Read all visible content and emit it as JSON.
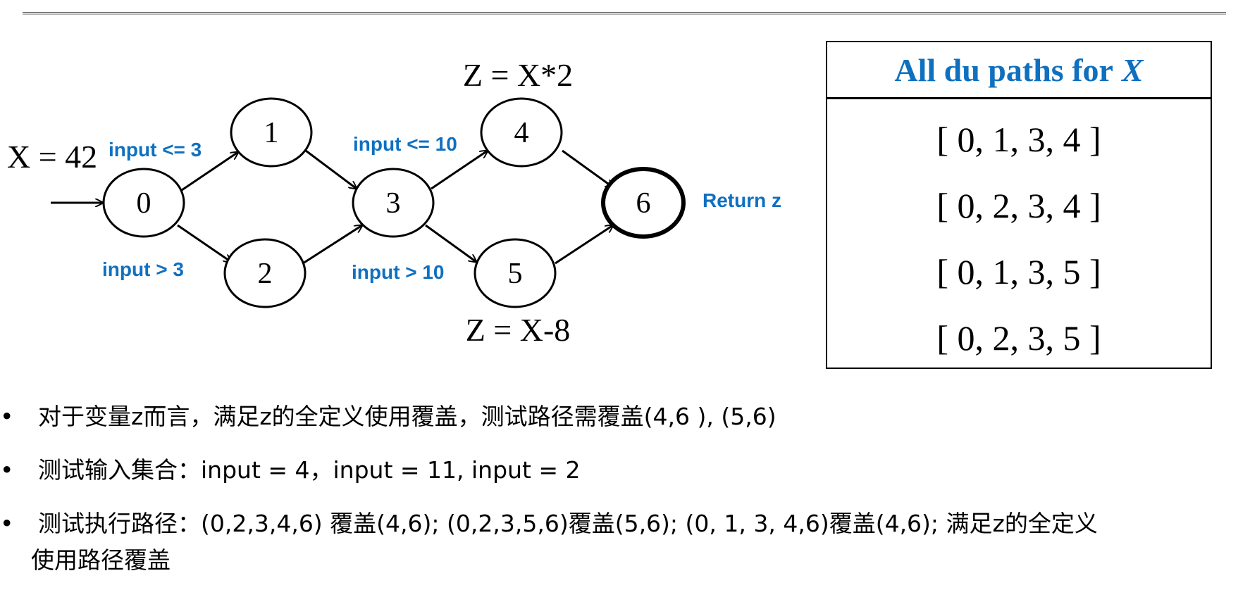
{
  "diagram": {
    "nodes": [
      "0",
      "1",
      "2",
      "3",
      "4",
      "5",
      "6"
    ],
    "entry_label": "X = 42",
    "conditions": {
      "to_1": "input <= 3",
      "to_2": "input > 3",
      "to_4": "input <= 10",
      "to_5": "input > 10"
    },
    "node4_def": "Z = X*2",
    "node5_def": "Z = X-8",
    "exit_label": "Return z",
    "accent_color": "#0f70c0"
  },
  "table": {
    "header_prefix": "All du paths for",
    "header_var": "X",
    "paths": [
      "[ 0, 1, 3, 4 ]",
      "[ 0, 2, 3, 4 ]",
      "[ 0, 1, 3, 5 ]",
      "[ 0, 2, 3, 5 ]"
    ]
  },
  "bullets": {
    "marker": "•",
    "b1": "对于变量z而言，满足z的全定义使用覆盖，测试路径需覆盖(4,6 ), (5,6)",
    "b2": "测试输入集合：input = 4，input = 11, input = 2",
    "b3_line1": "测试执行路径：(0,2,3,4,6) 覆盖(4,6);   (0,2,3,5,6)覆盖(5,6);  (0, 1, 3, 4,6)覆盖(4,6); 满足z的全定义",
    "b3_line2": "使用路径覆盖"
  }
}
